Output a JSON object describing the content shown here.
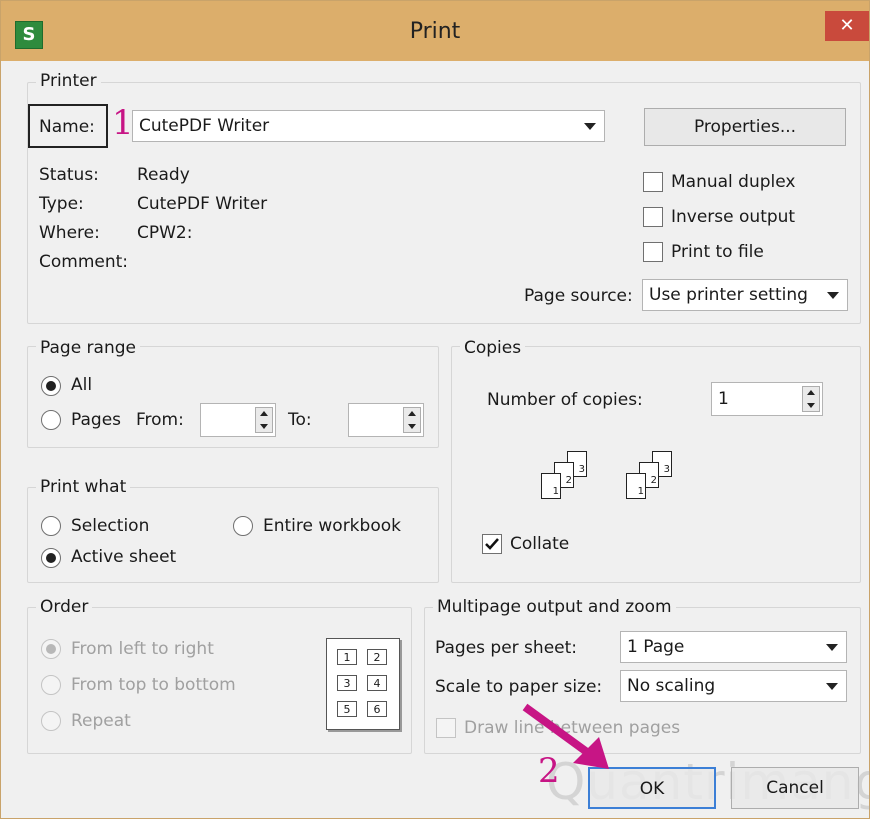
{
  "window": {
    "title": "Print",
    "app_icon": "S",
    "close_glyph": "✕"
  },
  "printer": {
    "legend": "Printer",
    "name_label": "Name:",
    "name_value": "CutePDF Writer",
    "properties_label": "Properties...",
    "status_label": "Status:",
    "status_value": "Ready",
    "type_label": "Type:",
    "type_value": "CutePDF Writer",
    "where_label": "Where:",
    "where_value": "CPW2:",
    "comment_label": "Comment:",
    "manual_duplex": "Manual duplex",
    "inverse_output": "Inverse output",
    "print_to_file": "Print to file",
    "page_source_label": "Page source:",
    "page_source_value": "Use printer setting"
  },
  "page_range": {
    "legend": "Page range",
    "all_label": "All",
    "pages_label": "Pages",
    "from_label": "From:",
    "to_label": "To:",
    "selected": "All"
  },
  "copies": {
    "legend": "Copies",
    "number_label": "Number of copies:",
    "number_value": "1",
    "collate_label": "Collate",
    "collate_checked": true,
    "stack_numbers": [
      "1",
      "2",
      "3"
    ]
  },
  "print_what": {
    "legend": "Print what",
    "selection_label": "Selection",
    "entire_workbook_label": "Entire workbook",
    "active_sheet_label": "Active sheet",
    "selected": "Active sheet"
  },
  "order": {
    "legend": "Order",
    "left_to_right": "From left to right",
    "top_to_bottom": "From top to bottom",
    "repeat": "Repeat",
    "selected": "From left to right",
    "grid_numbers": [
      "1",
      "2",
      "3",
      "4",
      "5",
      "6"
    ]
  },
  "multipage": {
    "legend": "Multipage output and zoom",
    "pages_per_sheet_label": "Pages per sheet:",
    "pages_per_sheet_value": "1 Page",
    "scale_label": "Scale to paper size:",
    "scale_value": "No scaling",
    "draw_line_label": "Draw line between pages"
  },
  "buttons": {
    "ok": "OK",
    "cancel": "Cancel"
  },
  "annotations": {
    "one": "1",
    "two": "2",
    "color": "#c71585"
  },
  "watermark": "Quantrimang"
}
